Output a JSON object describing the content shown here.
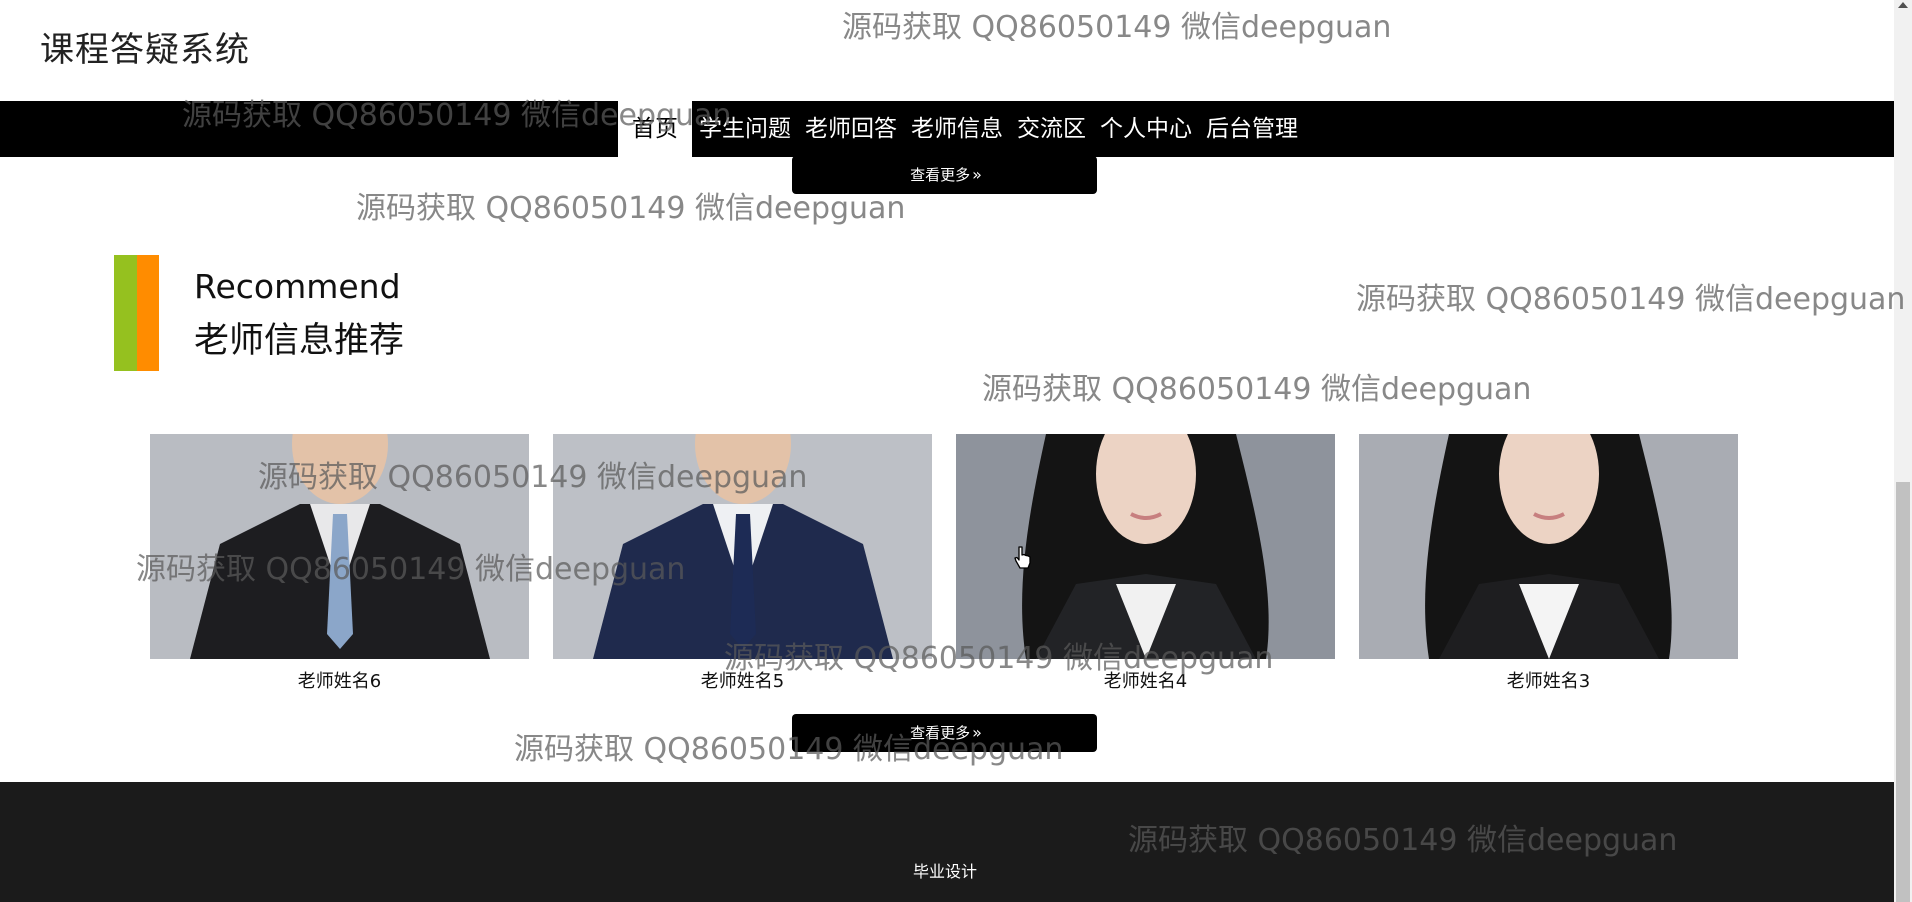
{
  "site": {
    "title": "课程答疑系统"
  },
  "nav": {
    "items": [
      "首页",
      "学生问题",
      "老师回答",
      "老师信息",
      "交流区",
      "个人中心",
      "后台管理"
    ],
    "active_index": 0
  },
  "buttons": {
    "see_more_top": "查看更多",
    "see_more_bottom": "查看更多"
  },
  "section": {
    "title_en": "Recommend",
    "title_zh": "老师信息推荐"
  },
  "teachers": [
    {
      "name": "老师姓名6",
      "suit": "#1d1d20",
      "tie": "#8ba6c9",
      "shirt": "#e8e8ea",
      "bg": "#b9bcc2",
      "gender": "male"
    },
    {
      "name": "老师姓名5",
      "suit": "#1f2a4d",
      "tie": "#1d2b55",
      "shirt": "#eef0f3",
      "bg": "#bdc0c6",
      "gender": "male"
    },
    {
      "name": "老师姓名4",
      "suit": "#222326",
      "tie": "",
      "shirt": "#f1f1f1",
      "bg": "#8e939c",
      "gender": "female"
    },
    {
      "name": "老师姓名3",
      "suit": "#1e1e20",
      "tie": "",
      "shirt": "#f4f4f4",
      "bg": "#a9acb3",
      "gender": "female"
    }
  ],
  "footer": {
    "text": "毕业设计"
  },
  "watermarks": [
    "源码获取 QQ86050149 微信deepguan",
    "源码获取 QQ86050149 微信deepguan",
    "源码获取 QQ86050149 微信deepguan",
    "源码获取 QQ86050149 微信deepguan",
    "源码获取 QQ86050149 微信deepguan",
    "源码获取 QQ86050149 微信deepguan",
    "源码获取 QQ86050149 微信deepguan",
    "源码获取 QQ86050149 微信deepguan",
    "源码获取 QQ86050149 微信deepguan",
    "源码获取 QQ86050149 微信deepguan"
  ],
  "colors": {
    "accent_green": "#95c11f",
    "accent_orange": "#ff8c00",
    "nav_bg": "#000000",
    "footer_bg": "#1b1b1b"
  }
}
